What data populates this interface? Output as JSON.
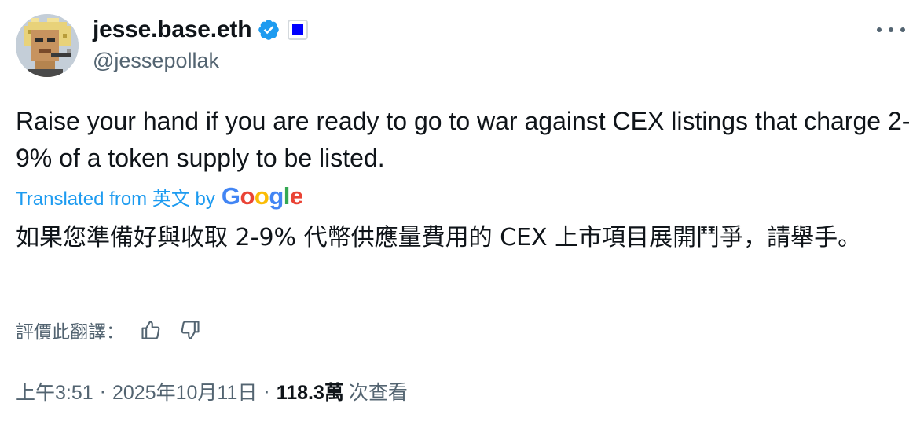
{
  "author": {
    "display_name": "jesse.base.eth",
    "handle": "@jessepollak",
    "avatar": "pixel-art-avatar",
    "verified_badge_color": "#1d9bf0",
    "affiliate_badge_color": "#0000ff"
  },
  "tweet": {
    "text": "Raise your hand if you are ready to go to war against CEX listings that charge 2-9% of a token supply to be listed."
  },
  "translation": {
    "prefix": "Translated from 英文 by",
    "provider": "Google",
    "text": "如果您準備好與收取 2-9% 代幣供應量費用的 CEX 上市項目展開鬥爭，請舉手。"
  },
  "rating": {
    "label": "評價此翻譯：",
    "up_icon": "thumbs-up-icon",
    "down_icon": "thumbs-down-icon"
  },
  "meta": {
    "time": "上午3:51",
    "date": "2025年10月11日",
    "views_count": "118.3萬",
    "views_label": "次查看",
    "separator": "·"
  },
  "colors": {
    "accent": "#1d9bf0",
    "text_primary": "#0f1419",
    "text_secondary": "#536471"
  }
}
